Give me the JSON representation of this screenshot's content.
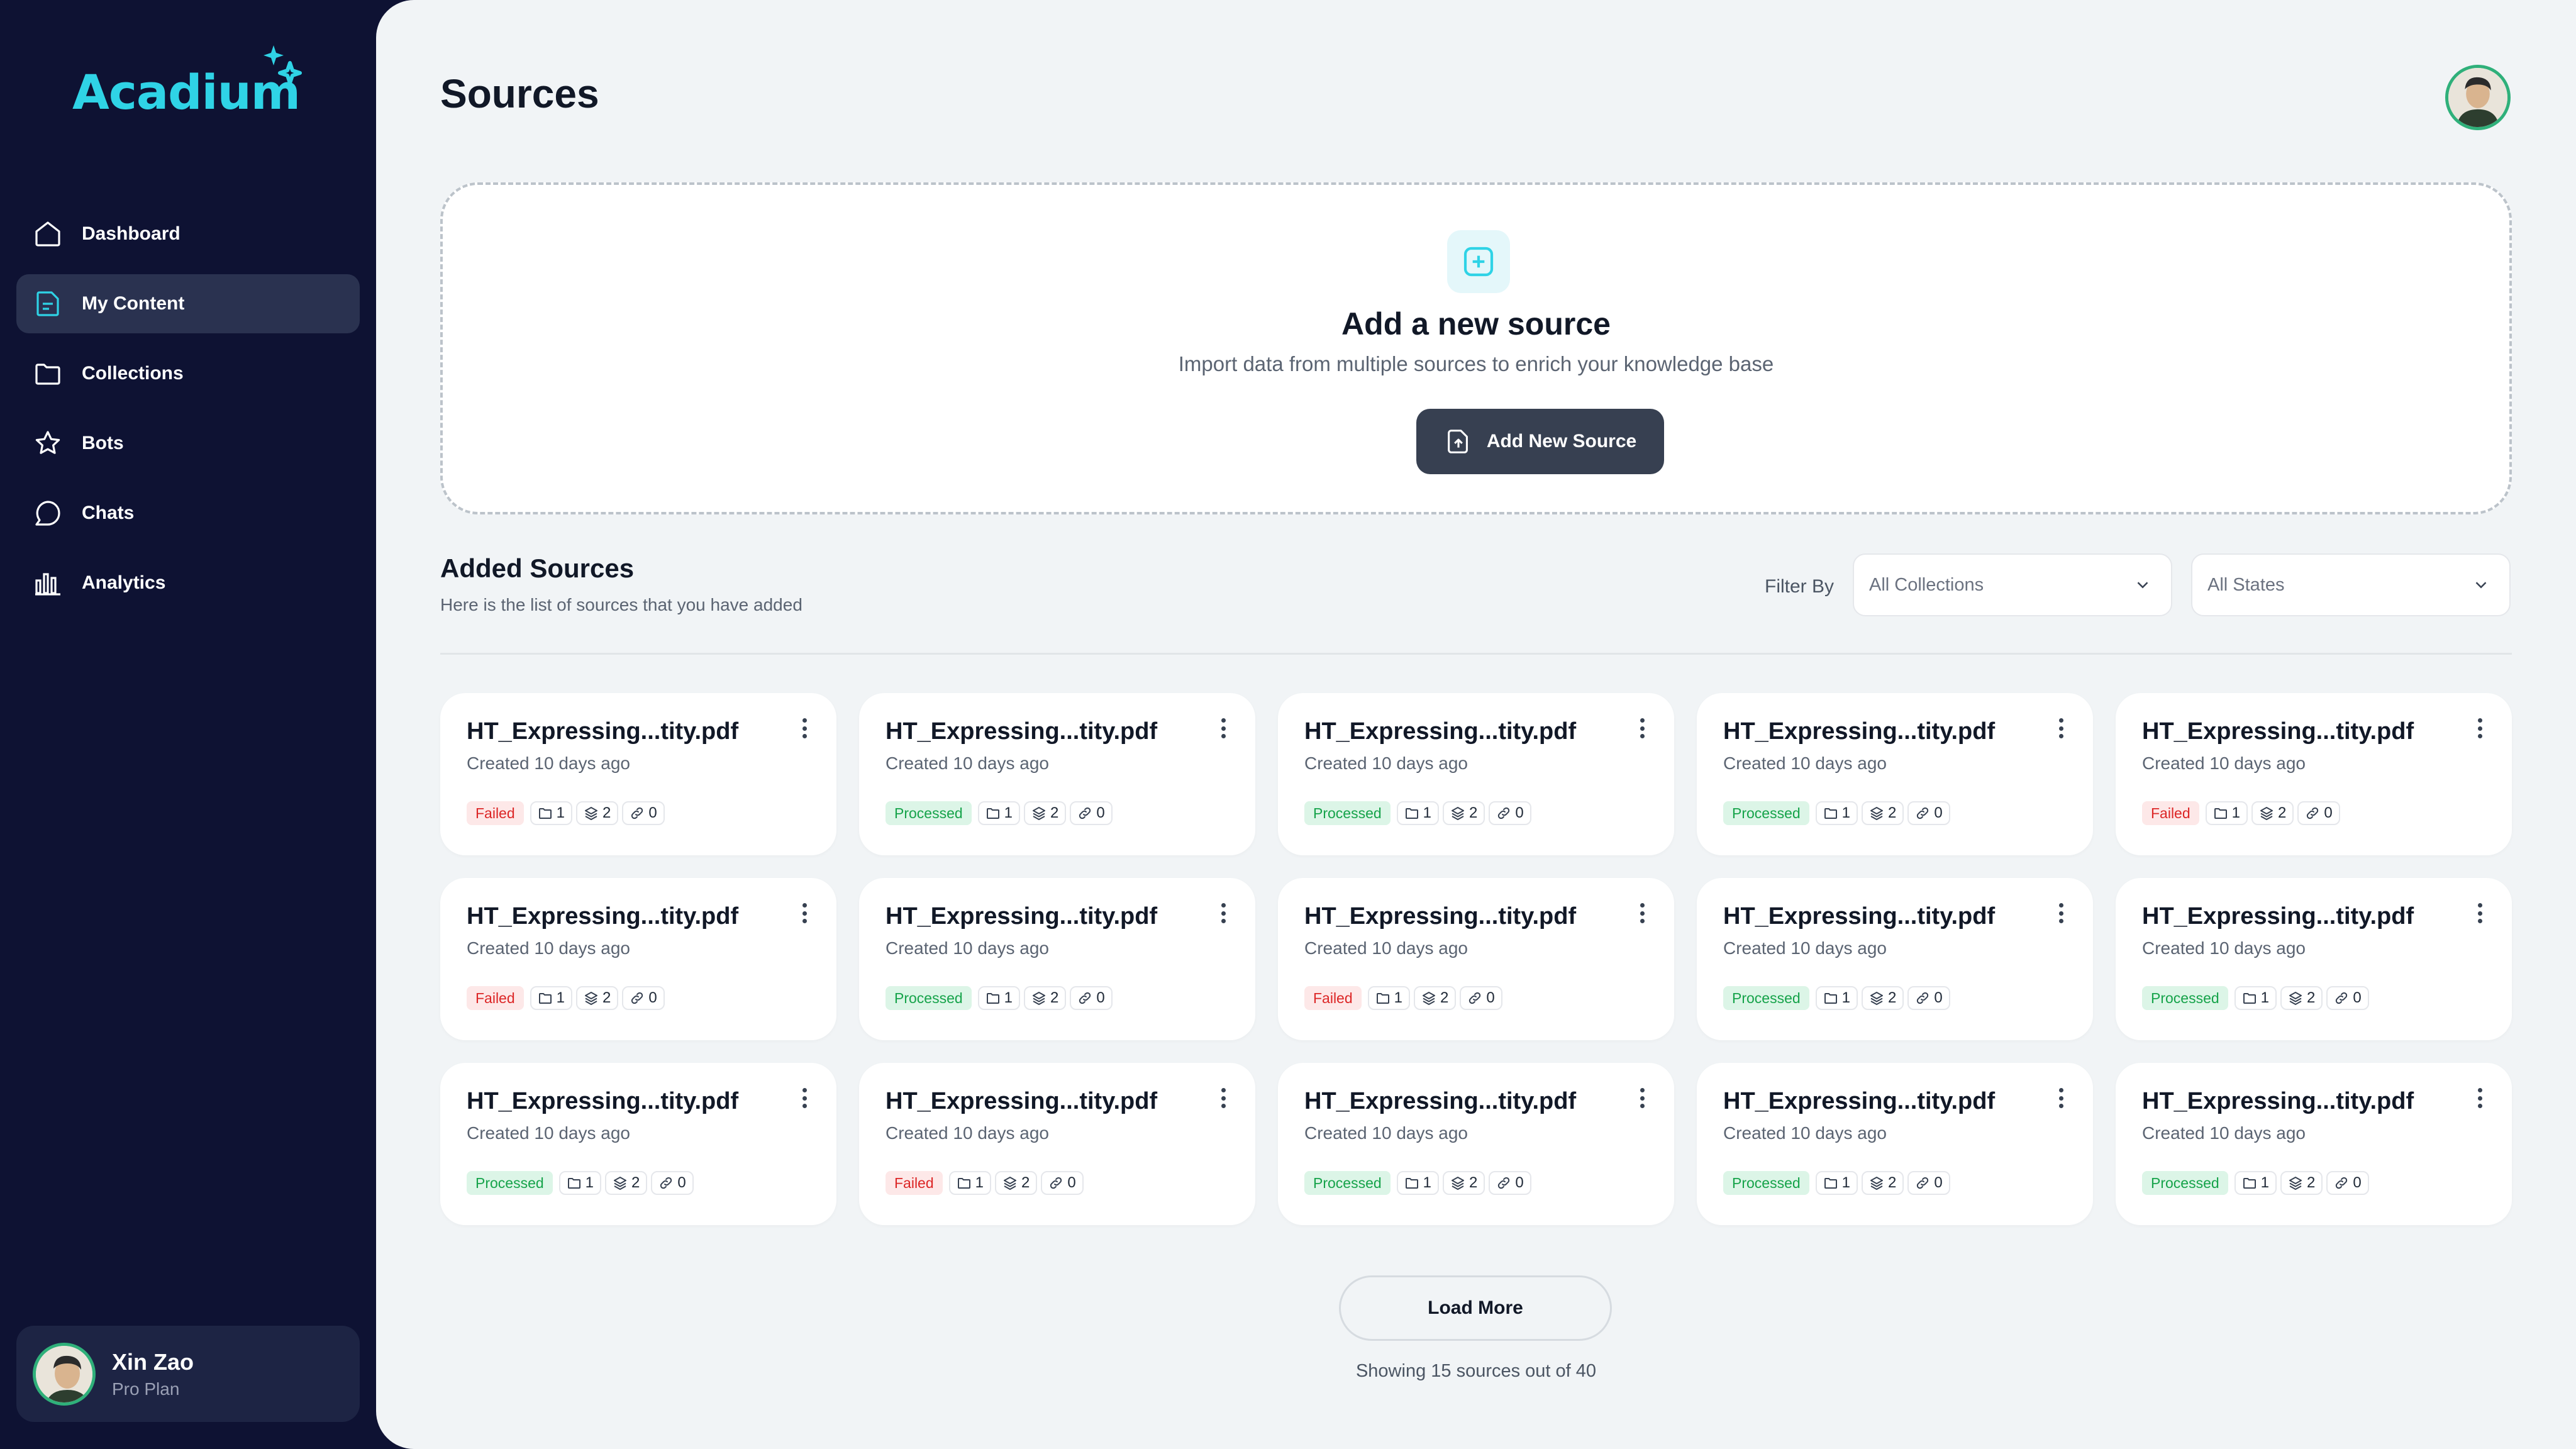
{
  "brand": {
    "name": "Acadium",
    "accent": "#2fd3e6"
  },
  "sidebar": {
    "items": [
      {
        "label": "Dashboard",
        "icon": "home-icon"
      },
      {
        "label": "My Content",
        "icon": "document-icon",
        "active": true
      },
      {
        "label": "Collections",
        "icon": "folder-icon"
      },
      {
        "label": "Bots",
        "icon": "star-icon"
      },
      {
        "label": "Chats",
        "icon": "chat-icon"
      },
      {
        "label": "Analytics",
        "icon": "bar-chart-icon"
      }
    ]
  },
  "user": {
    "name": "Xin Zao",
    "plan": "Pro Plan"
  },
  "page": {
    "title": "Sources"
  },
  "dropzone": {
    "title": "Add a new source",
    "subtitle": "Import data from multiple sources to enrich your knowledge base",
    "button_label": "Add New Source"
  },
  "added": {
    "title": "Added Sources",
    "subtitle": "Here is the list of sources that you have added",
    "filter_label": "Filter By",
    "collections_select": "All Collections",
    "states_select": "All States"
  },
  "sources": [
    {
      "name": "HT_Expressing...tity.pdf",
      "created": "Created 10 days ago",
      "status": "Failed",
      "folders": "1",
      "layers": "2",
      "links": "0"
    },
    {
      "name": "HT_Expressing...tity.pdf",
      "created": "Created 10 days ago",
      "status": "Processed",
      "folders": "1",
      "layers": "2",
      "links": "0"
    },
    {
      "name": "HT_Expressing...tity.pdf",
      "created": "Created 10 days ago",
      "status": "Processed",
      "folders": "1",
      "layers": "2",
      "links": "0"
    },
    {
      "name": "HT_Expressing...tity.pdf",
      "created": "Created 10 days ago",
      "status": "Processed",
      "folders": "1",
      "layers": "2",
      "links": "0"
    },
    {
      "name": "HT_Expressing...tity.pdf",
      "created": "Created 10 days ago",
      "status": "Failed",
      "folders": "1",
      "layers": "2",
      "links": "0"
    },
    {
      "name": "HT_Expressing...tity.pdf",
      "created": "Created 10 days ago",
      "status": "Failed",
      "folders": "1",
      "layers": "2",
      "links": "0"
    },
    {
      "name": "HT_Expressing...tity.pdf",
      "created": "Created 10 days ago",
      "status": "Processed",
      "folders": "1",
      "layers": "2",
      "links": "0"
    },
    {
      "name": "HT_Expressing...tity.pdf",
      "created": "Created 10 days ago",
      "status": "Failed",
      "folders": "1",
      "layers": "2",
      "links": "0"
    },
    {
      "name": "HT_Expressing...tity.pdf",
      "created": "Created 10 days ago",
      "status": "Processed",
      "folders": "1",
      "layers": "2",
      "links": "0"
    },
    {
      "name": "HT_Expressing...tity.pdf",
      "created": "Created 10 days ago",
      "status": "Processed",
      "folders": "1",
      "layers": "2",
      "links": "0"
    },
    {
      "name": "HT_Expressing...tity.pdf",
      "created": "Created 10 days ago",
      "status": "Processed",
      "folders": "1",
      "layers": "2",
      "links": "0"
    },
    {
      "name": "HT_Expressing...tity.pdf",
      "created": "Created 10 days ago",
      "status": "Failed",
      "folders": "1",
      "layers": "2",
      "links": "0"
    },
    {
      "name": "HT_Expressing...tity.pdf",
      "created": "Created 10 days ago",
      "status": "Processed",
      "folders": "1",
      "layers": "2",
      "links": "0"
    },
    {
      "name": "HT_Expressing...tity.pdf",
      "created": "Created 10 days ago",
      "status": "Processed",
      "folders": "1",
      "layers": "2",
      "links": "0"
    },
    {
      "name": "HT_Expressing...tity.pdf",
      "created": "Created 10 days ago",
      "status": "Processed",
      "folders": "1",
      "layers": "2",
      "links": "0"
    }
  ],
  "pagination": {
    "load_more": "Load More",
    "showing": "Showing 15 sources out of 40"
  }
}
